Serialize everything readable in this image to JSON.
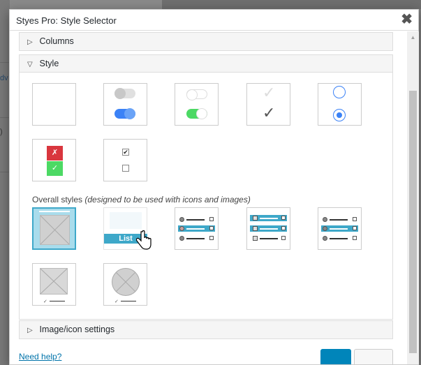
{
  "modal": {
    "title": "Styes Pro: Style Selector",
    "close_glyph": "✖"
  },
  "sections": {
    "columns": {
      "label": "Columns",
      "arrow": "▷"
    },
    "style": {
      "label": "Style",
      "arrow": "▽"
    },
    "image_icon": {
      "label": "Image/icon settings",
      "arrow": "▷"
    }
  },
  "overall": {
    "label": "Overall styles",
    "note": "(designed to be used with icons and images)"
  },
  "list_tag": "List",
  "background": {
    "link_fragment": "dv",
    "paren": ")"
  },
  "footer": {
    "help_link": "Need help?"
  },
  "icons": {
    "check_light": "✓",
    "check_dark": "✓",
    "x_mark": "✗",
    "tick_mark": "✓",
    "checkbox_checked": "✔"
  },
  "colors": {
    "accent": "#3ea8c9",
    "toggle_on_blue": "#3b82f6",
    "toggle_on_green": "#4cd964",
    "red": "#d9363e",
    "green": "#4cd964",
    "primary_button": "#0085ba"
  }
}
